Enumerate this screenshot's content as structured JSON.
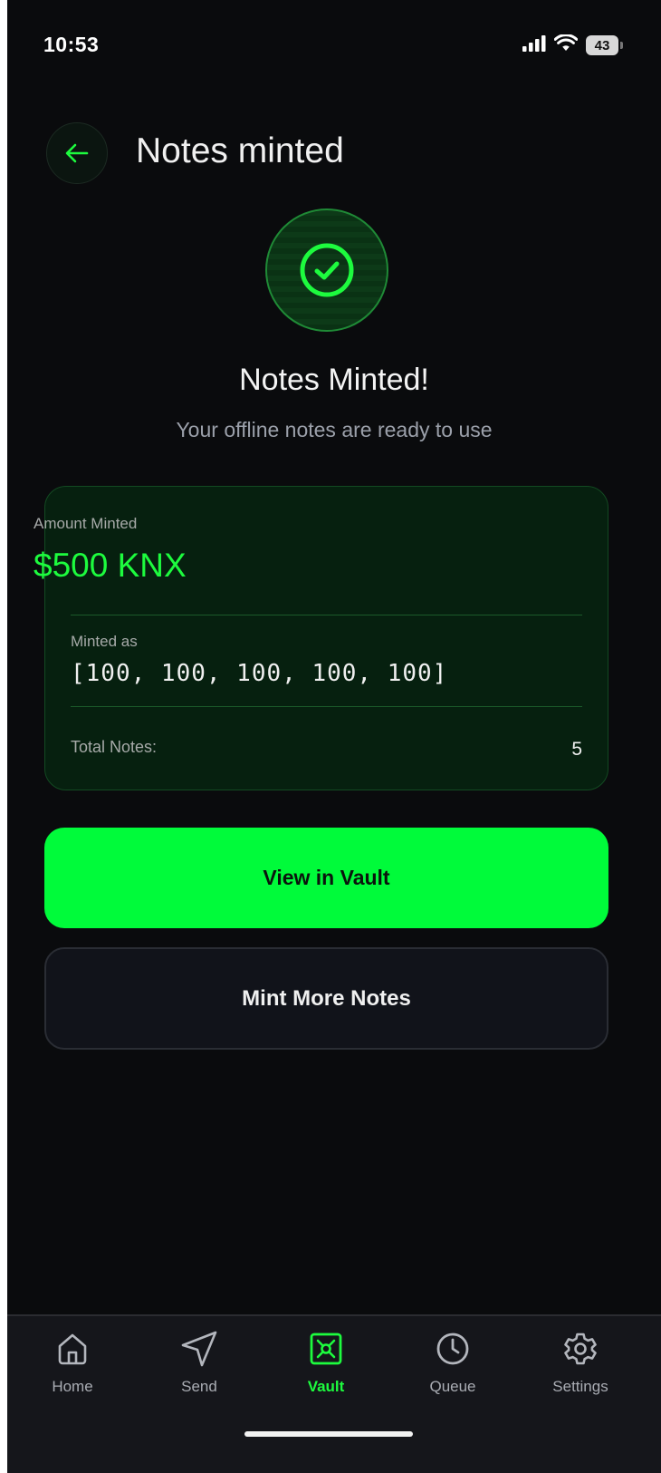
{
  "status_bar": {
    "time": "10:53",
    "battery": "43"
  },
  "header": {
    "title": "Notes minted"
  },
  "success": {
    "headline": "Notes Minted!",
    "subtitle": "Your offline notes are ready to use"
  },
  "summary": {
    "amount_label": "Amount Minted",
    "amount_value": "$500 KNX",
    "minted_as_label": "Minted as",
    "minted_as_value": "[100, 100, 100, 100, 100]",
    "total_label": "Total Notes:",
    "total_value": "5"
  },
  "actions": {
    "primary_label": "View in Vault",
    "secondary_label": "Mint More Notes"
  },
  "tab_bar": {
    "active": "Vault",
    "items": [
      {
        "label": "Home",
        "icon": "home-icon"
      },
      {
        "label": "Send",
        "icon": "send-icon"
      },
      {
        "label": "Vault",
        "icon": "vault-icon"
      },
      {
        "label": "Queue",
        "icon": "clock-icon"
      },
      {
        "label": "Settings",
        "icon": "gear-icon"
      }
    ]
  },
  "colors": {
    "accent": "#00fb3a",
    "background": "#0a0b0d",
    "card": "#06200f"
  }
}
